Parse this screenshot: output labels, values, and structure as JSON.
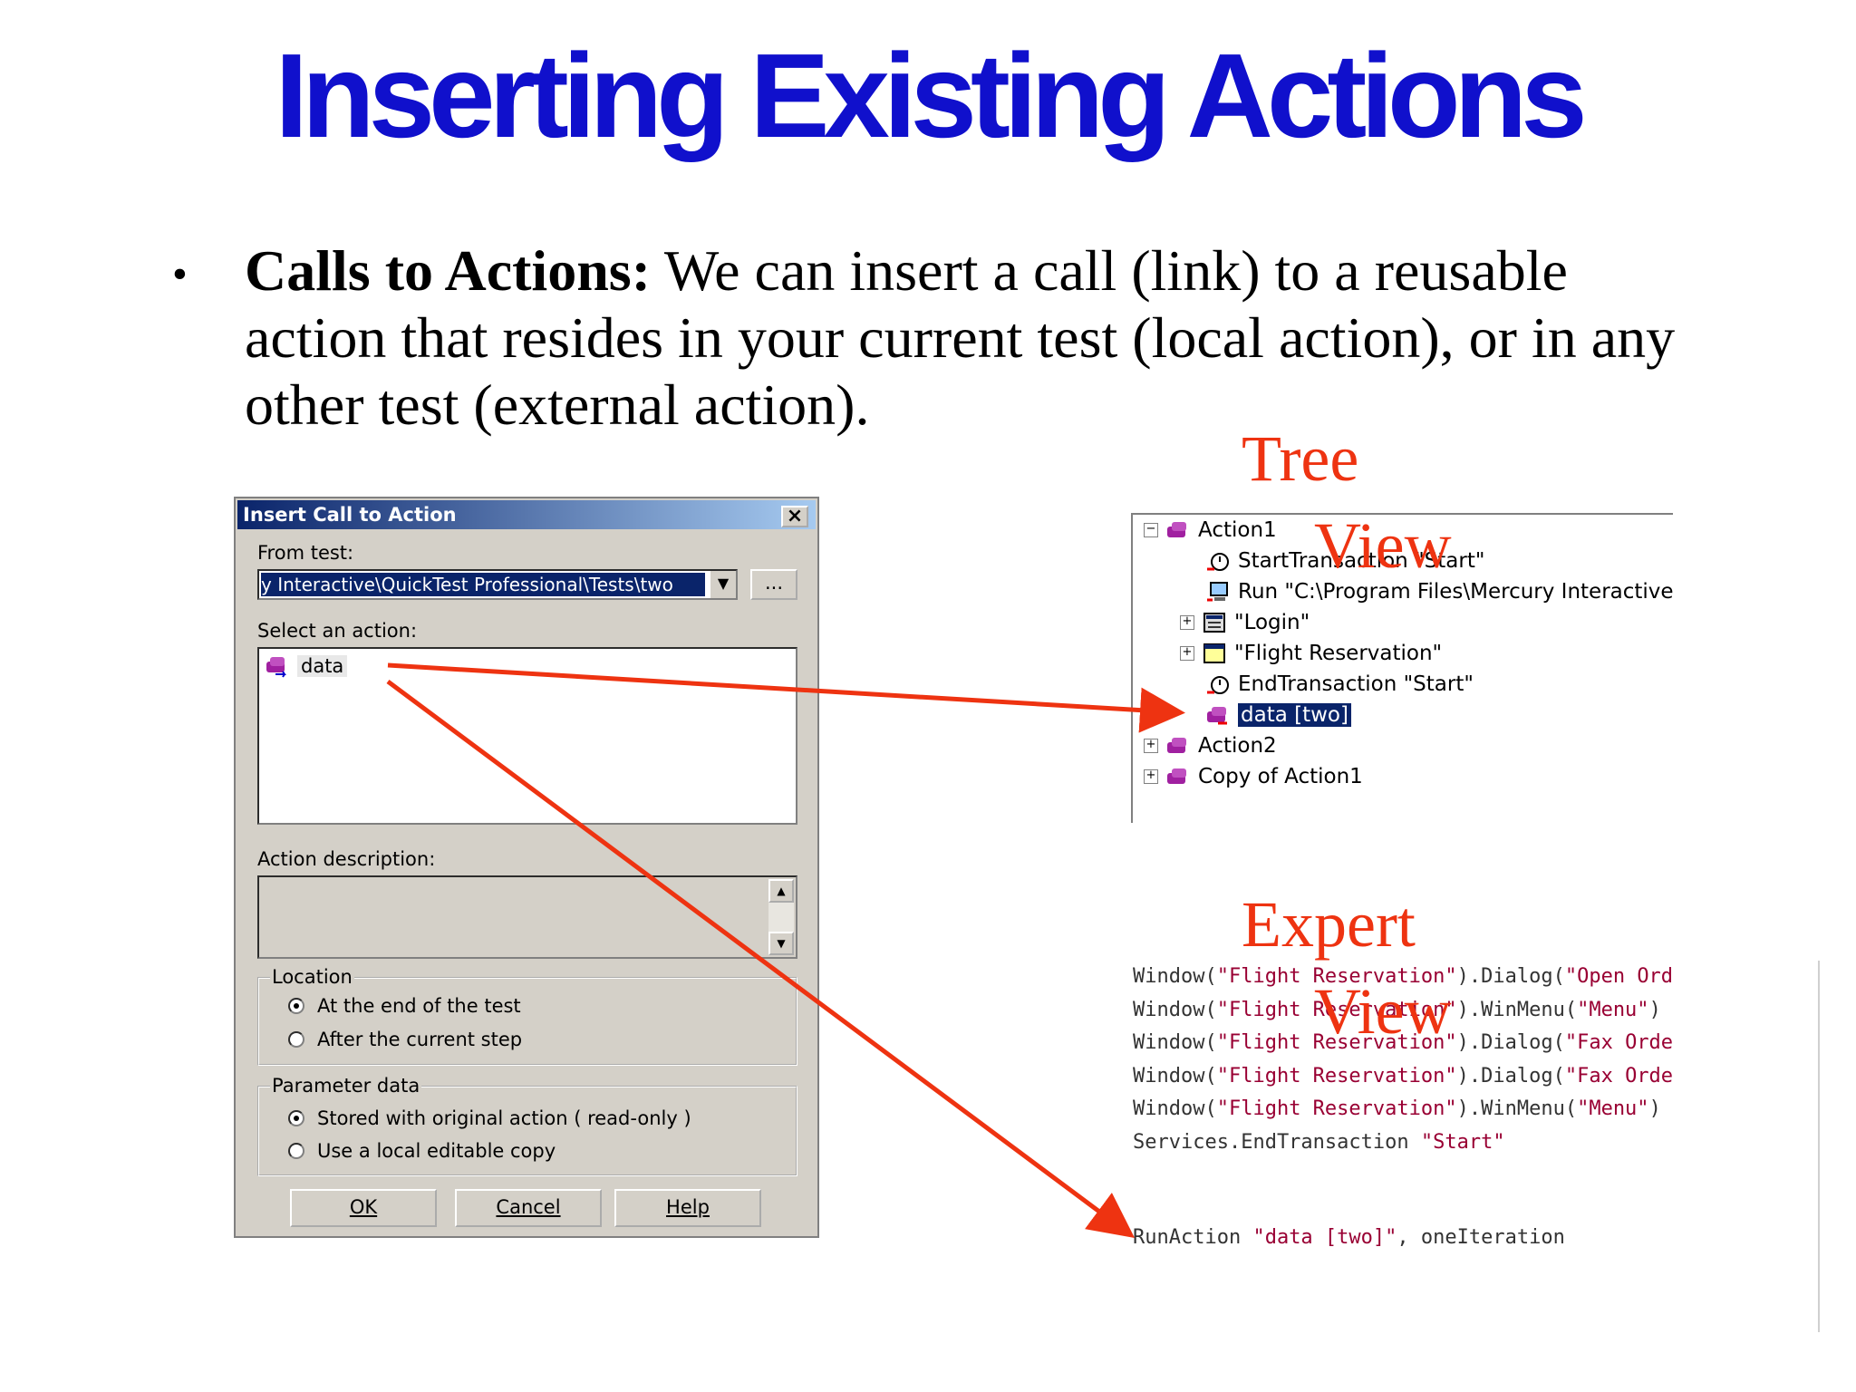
{
  "slide": {
    "title": "Inserting Existing Actions",
    "bullet_lead": "Calls to Actions:",
    "bullet_text": " We can insert a call (link) to a reusable action that resides in your current test (local action), or in any other test (external action)."
  },
  "dialog": {
    "title": "Insert Call to Action",
    "close_glyph": "×",
    "from_test_label": "From test:",
    "from_test_value": "y Interactive\\QuickTest Professional\\Tests\\two",
    "browse_label": "...",
    "select_label": "Select an action:",
    "actions": [
      {
        "label": "data"
      }
    ],
    "description_label": "Action description:",
    "location": {
      "title": "Location",
      "options": [
        "At the end of the test",
        "After the current step"
      ],
      "selected": 0
    },
    "parameter": {
      "title": "Parameter data",
      "options": [
        "Stored with original action ( read-only )",
        "Use a local editable copy"
      ],
      "selected": 0
    },
    "buttons": {
      "ok": "OK",
      "cancel": "Cancel",
      "help": "Help"
    }
  },
  "tree_view": {
    "label_line1": "Tree",
    "label_line2": "View",
    "items": [
      {
        "label": "Action1",
        "icon": "action-icon",
        "expander": "−"
      },
      {
        "label": "StartTransaction \"Start\"",
        "icon": "stopwatch-icon"
      },
      {
        "label": "Run \"C:\\Program Files\\Mercury Interactive\\Qu",
        "icon": "computer-icon"
      },
      {
        "label": "\"Login\"",
        "icon": "dialog-icon",
        "expander": "+"
      },
      {
        "label": "\"Flight Reservation\"",
        "icon": "window-icon",
        "expander": "+"
      },
      {
        "label": "EndTransaction \"Start\"",
        "icon": "stopwatch-icon"
      },
      {
        "label": "data [two]",
        "icon": "action-icon",
        "selected": true
      },
      {
        "label": "Action2",
        "icon": "action-icon",
        "expander": "+"
      },
      {
        "label": "Copy of Action1",
        "icon": "action-icon",
        "expander": "+"
      }
    ]
  },
  "expert_view": {
    "label_line1": "Expert",
    "label_line2": "View",
    "lines": [
      [
        "Window(",
        "\"Flight Reservation\"",
        ").Dialog(",
        "\"Open Ord"
      ],
      [
        "Window(",
        "\"Flight Reservation\"",
        ").WinMenu(",
        "\"Menu\"",
        ")"
      ],
      [
        "Window(",
        "\"Flight Reservation\"",
        ").Dialog(",
        "\"Fax Orde"
      ],
      [
        "Window(",
        "\"Flight Reservation\"",
        ").Dialog(",
        "\"Fax Orde"
      ],
      [
        "Window(",
        "\"Flight Reservation\"",
        ").WinMenu(",
        "\"Menu\"",
        ")"
      ],
      [
        "Services.EndTransaction ",
        "\"Start\""
      ]
    ],
    "run_action": [
      "RunAction ",
      "\"data [two]\"",
      ", oneIteration"
    ]
  },
  "colors": {
    "title": "#1010cc",
    "annotation": "#ee3311",
    "selection": "#0a246a"
  }
}
